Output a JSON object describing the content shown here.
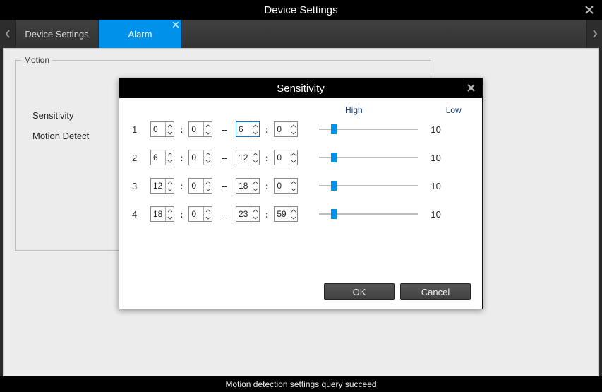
{
  "titlebar": {
    "title": "Device Settings"
  },
  "tabs": [
    {
      "label": "Device Settings",
      "active": false
    },
    {
      "label": "Alarm",
      "active": true
    }
  ],
  "motion": {
    "legend": "Motion",
    "menu": {
      "sensitivity": "Sensitivity",
      "motion_detect": "Motion Detect"
    }
  },
  "modal": {
    "title": "Sensitivity",
    "header": {
      "high": "High",
      "low": "Low"
    },
    "rows": [
      {
        "num": "1",
        "h1": "0",
        "m1": "0",
        "h2": "6",
        "m2": "0",
        "slider_pct": 12,
        "value": "10",
        "focused": "h2"
      },
      {
        "num": "2",
        "h1": "6",
        "m1": "0",
        "h2": "12",
        "m2": "0",
        "slider_pct": 12,
        "value": "10"
      },
      {
        "num": "3",
        "h1": "12",
        "m1": "0",
        "h2": "18",
        "m2": "0",
        "slider_pct": 12,
        "value": "10"
      },
      {
        "num": "4",
        "h1": "18",
        "m1": "0",
        "h2": "23",
        "m2": "59",
        "slider_pct": 12,
        "value": "10"
      }
    ],
    "buttons": {
      "ok": "OK",
      "cancel": "Cancel"
    }
  },
  "status": "Motion detection settings query succeed"
}
